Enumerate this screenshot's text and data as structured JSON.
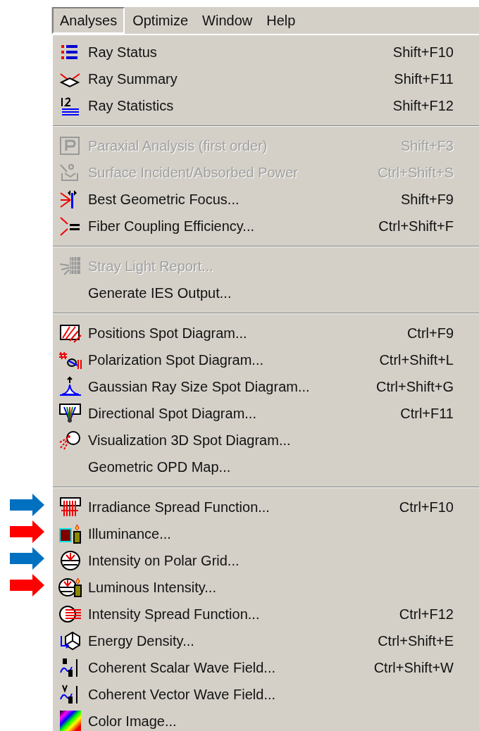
{
  "menu_bar": [
    {
      "label": "Analyses",
      "selected": true
    },
    {
      "label": "Optimize",
      "selected": false
    },
    {
      "label": "Window",
      "selected": false
    },
    {
      "label": "Help",
      "selected": false
    }
  ],
  "menu_groups": [
    [
      {
        "label": "Ray Status",
        "shortcut": "Shift+F10",
        "disabled": false
      },
      {
        "label": "Ray Summary",
        "shortcut": "Shift+F11",
        "disabled": false
      },
      {
        "label": "Ray Statistics",
        "shortcut": "Shift+F12",
        "disabled": false
      }
    ],
    [
      {
        "label": "Paraxial Analysis (first order)",
        "shortcut": "Shift+F3",
        "disabled": true
      },
      {
        "label": "Surface Incident/Absorbed Power",
        "shortcut": "Ctrl+Shift+S",
        "disabled": true
      },
      {
        "label": "Best Geometric Focus...",
        "shortcut": "Shift+F9",
        "disabled": false
      },
      {
        "label": "Fiber Coupling Efficiency...",
        "shortcut": "Ctrl+Shift+F",
        "disabled": false
      }
    ],
    [
      {
        "label": "Stray Light Report...",
        "disabled": true
      },
      {
        "label": "Generate IES Output...",
        "disabled": false
      }
    ],
    [
      {
        "label": "Positions Spot Diagram...",
        "shortcut": "Ctrl+F9",
        "disabled": false
      },
      {
        "label": "Polarization Spot Diagram...",
        "shortcut": "Ctrl+Shift+L",
        "disabled": false
      },
      {
        "label": "Gaussian Ray Size Spot Diagram...",
        "shortcut": "Ctrl+Shift+G",
        "disabled": false
      },
      {
        "label": "Directional Spot Diagram...",
        "shortcut": "Ctrl+F11",
        "disabled": false
      },
      {
        "label": "Visualization 3D Spot Diagram...",
        "disabled": false
      },
      {
        "label": "Geometric OPD Map...",
        "disabled": false
      }
    ],
    [
      {
        "label": "Irradiance Spread Function...",
        "shortcut": "Ctrl+F10",
        "disabled": false,
        "arrow": {
          "color": "#0070c0"
        }
      },
      {
        "label": "Illuminance...",
        "disabled": false,
        "arrow": {
          "color": "#ff0000"
        }
      },
      {
        "label": "Intensity on Polar Grid...",
        "disabled": false,
        "arrow": {
          "color": "#0070c0"
        }
      },
      {
        "label": "Luminous Intensity...",
        "disabled": false,
        "arrow": {
          "color": "#ff0000"
        }
      },
      {
        "label": "Intensity Spread Function...",
        "shortcut": "Ctrl+F12",
        "disabled": false
      },
      {
        "label": "Energy Density...",
        "shortcut": "Ctrl+Shift+E",
        "disabled": false
      },
      {
        "label": "Coherent Scalar Wave Field...",
        "shortcut": "Ctrl+Shift+W",
        "disabled": false
      },
      {
        "label": "Coherent Vector Wave Field...",
        "disabled": false
      },
      {
        "label": "Color Image...",
        "disabled": false
      }
    ]
  ]
}
